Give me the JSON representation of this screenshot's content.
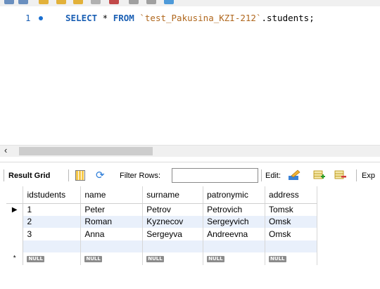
{
  "editor": {
    "line_number": "1",
    "sql": {
      "select": "SELECT",
      "star": " * ",
      "from": "FROM",
      "space": " ",
      "table": "`test_Pakusina_KZI-212`",
      "rest": ".students;"
    }
  },
  "result_toolbar": {
    "result_grid_label": "Result Grid",
    "filter_rows_label": "Filter Rows:",
    "filter_value": "",
    "edit_label": "Edit:",
    "export_label": "Exp"
  },
  "grid": {
    "columns": [
      "idstudents",
      "name",
      "surname",
      "patronymic",
      "address"
    ],
    "rows": [
      [
        "1",
        "Peter",
        "Petrov",
        "Petrovich",
        "Tomsk"
      ],
      [
        "2",
        "Roman",
        "Kyznecov",
        "Sergeyvich",
        "Omsk"
      ],
      [
        "3",
        "Anna",
        "Sergeyva",
        "Andreevna",
        "Omsk"
      ]
    ],
    "null_label": "NULL",
    "current_row_marker": "▶",
    "new_row_marker": "*"
  },
  "colors": {
    "keyword": "#1a5fb4",
    "identifier": "#b0671d",
    "alt_row": "#e9f0fb"
  }
}
